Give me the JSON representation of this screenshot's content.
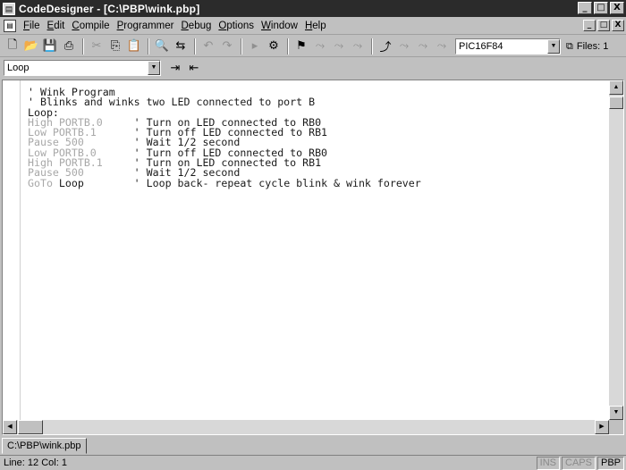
{
  "window": {
    "title": "CodeDesigner - [C:\\PBP\\wink.pbp]",
    "minimize": "_",
    "restore": "□",
    "close": "X"
  },
  "menu": {
    "items": [
      {
        "hot": "F",
        "rest": "ile"
      },
      {
        "hot": "E",
        "rest": "dit"
      },
      {
        "hot": "C",
        "rest": "ompile"
      },
      {
        "hot": "P",
        "rest": "rogrammer"
      },
      {
        "hot": "D",
        "rest": "ebug"
      },
      {
        "hot": "O",
        "rest": "ptions"
      },
      {
        "hot": "W",
        "rest": "indow"
      },
      {
        "hot": "H",
        "rest": "elp"
      }
    ]
  },
  "toolbar": {
    "device": "PIC16F84",
    "files_label": "Files: 1",
    "icons": [
      "new-file-icon",
      "open-folder-icon",
      "save-icon",
      "print-icon",
      "sep",
      "cut-icon",
      "copy-icon",
      "paste-icon",
      "sep",
      "find-icon",
      "find-replace-icon",
      "sep",
      "undo-icon",
      "redo-icon",
      "sep",
      "run-icon",
      "compile-icon",
      "sep",
      "toggle-bookmark-icon",
      "next-bookmark-icon",
      "prev-bookmark-icon",
      "clear-bookmarks-icon",
      "sep",
      "program-icon",
      "read-icon",
      "verify-icon",
      "erase-icon"
    ]
  },
  "toolbar2": {
    "label_value": "Loop"
  },
  "editor": {
    "lines": [
      [
        {
          "t": "' Wink Program",
          "c": "cm"
        }
      ],
      [
        {
          "t": "' Blinks and winks two LED connected to port B",
          "c": "cm"
        }
      ],
      [
        {
          "t": "Loop:",
          "c": "cm"
        }
      ],
      [
        {
          "t": "High PORTB.0",
          "c": "kw"
        },
        {
          "t": "     ' Turn on LED connected to RB0",
          "c": "cm"
        }
      ],
      [
        {
          "t": "Low PORTB.1",
          "c": "kw"
        },
        {
          "t": "      ' Turn off LED connected to RB1",
          "c": "cm"
        }
      ],
      [
        {
          "t": "Pause 500",
          "c": "kw"
        },
        {
          "t": "        ' Wait 1/2 second",
          "c": "cm"
        }
      ],
      [
        {
          "t": "Low PORTB.0",
          "c": "kw"
        },
        {
          "t": "      ' Turn off LED connected to RB0",
          "c": "cm"
        }
      ],
      [
        {
          "t": "High PORTB.1",
          "c": "kw"
        },
        {
          "t": "     ' Turn on LED connected to RB1",
          "c": "cm"
        }
      ],
      [
        {
          "t": "Pause 500",
          "c": "kw"
        },
        {
          "t": "        ' Wait 1/2 second",
          "c": "cm"
        }
      ],
      [
        {
          "t": "GoTo",
          "c": "kw"
        },
        {
          "t": " Loop",
          "c": "cm"
        },
        {
          "t": "        ' Loop back- repeat cycle blink & wink forever",
          "c": "cm"
        }
      ]
    ]
  },
  "doc_tab": "C:\\PBP\\wink.pbp",
  "status": {
    "position": "Line: 12 Col: 1",
    "ins": "INS",
    "caps": "CAPS",
    "mode": "PBP"
  }
}
